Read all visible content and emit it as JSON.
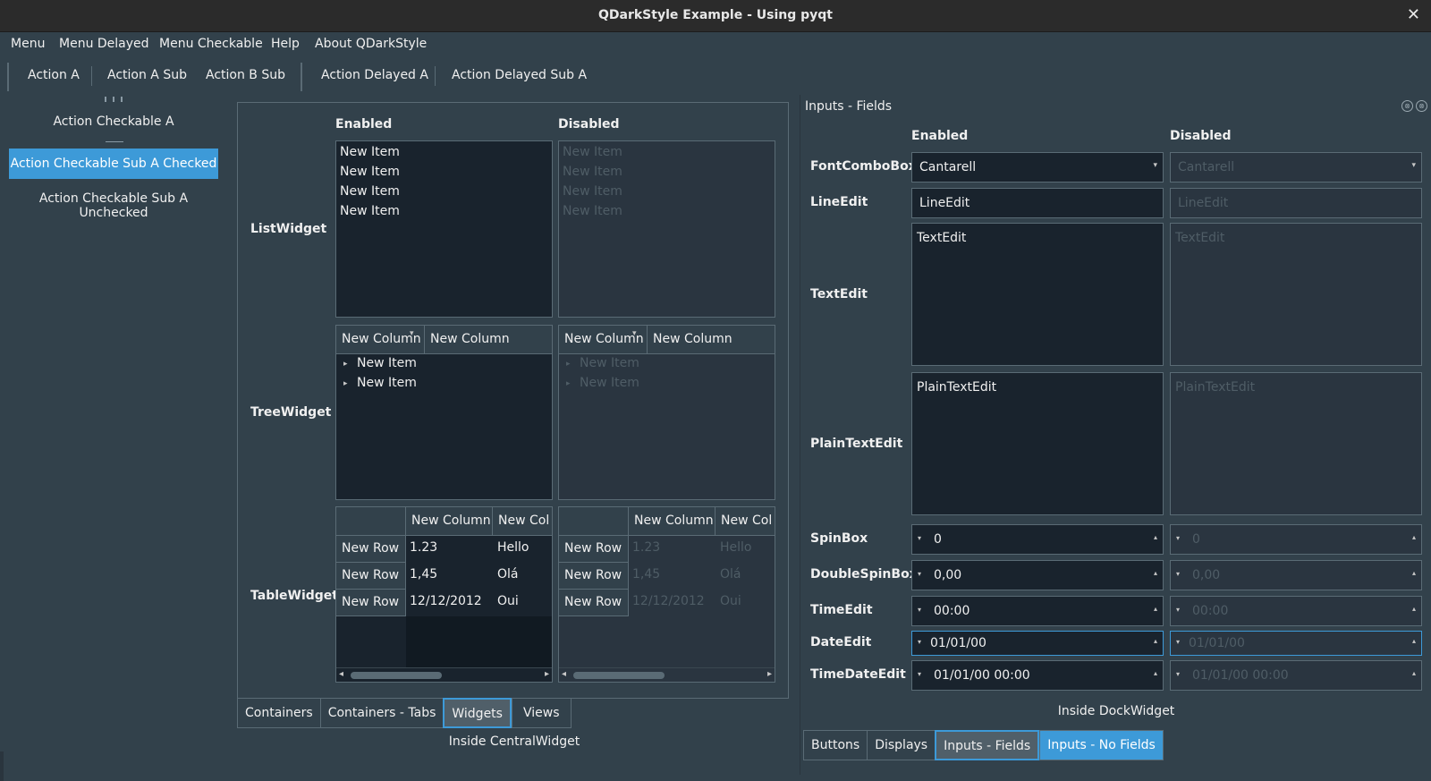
{
  "window": {
    "title": "QDarkStyle Example - Using pyqt",
    "close_glyph": "✕"
  },
  "menubar": [
    "Menu",
    "Menu Delayed",
    "Menu Checkable",
    "Help",
    "About QDarkStyle"
  ],
  "toolbar": [
    "Action A",
    "Action A Sub",
    "Action B Sub",
    "Action Delayed A",
    "Action Delayed Sub A"
  ],
  "left_toolbar": {
    "action_a": "Action Checkable A",
    "checked": "Action Checkable Sub A Checked",
    "unchecked": "Action Checkable Sub A Unchecked"
  },
  "central": {
    "enabled": "Enabled",
    "disabled": "Disabled",
    "list_label": "ListWidget",
    "tree_label": "TreeWidget",
    "table_label": "TableWidget",
    "list_items": [
      "New Item",
      "New Item",
      "New Item",
      "New Item"
    ],
    "tree_cols": [
      "New Column",
      "New Column"
    ],
    "tree_items": [
      "New Item",
      "New Item"
    ],
    "table_cols": [
      "New Column",
      "New Col"
    ],
    "table_rows": [
      {
        "header": "New Row",
        "c1": "1.23",
        "c2": "Hello"
      },
      {
        "header": "New Row",
        "c1": "1,45",
        "c2": "Olá"
      },
      {
        "header": "New Row",
        "c1": "12/12/2012",
        "c2": "Oui"
      }
    ],
    "tabs": [
      "Containers",
      "Containers - Tabs",
      "Widgets",
      "Views"
    ],
    "caption": "Inside CentralWidget"
  },
  "dock": {
    "title": "Inputs - Fields",
    "enabled": "Enabled",
    "disabled": "Disabled",
    "labels": {
      "font": "FontComboBox",
      "line": "LineEdit",
      "text": "TextEdit",
      "plain": "PlainTextEdit",
      "spin": "SpinBox",
      "dspin": "DoubleSpinBox",
      "time": "TimeEdit",
      "date": "DateEdit",
      "timedate": "TimeDateEdit"
    },
    "values": {
      "font": "Cantarell",
      "line": "LineEdit",
      "text": "TextEdit",
      "plain": "PlainTextEdit",
      "spin": "0",
      "dspin": "0,00",
      "time": "00:00",
      "date": "01/01/00",
      "timedate": "01/01/00 00:00"
    },
    "tabs": [
      "Buttons",
      "Displays",
      "Inputs - Fields",
      "Inputs - No Fields"
    ],
    "caption": "Inside DockWidget"
  },
  "colors": {
    "background": "#32414b",
    "accent": "#3d9ad8",
    "field": "#19232d"
  }
}
